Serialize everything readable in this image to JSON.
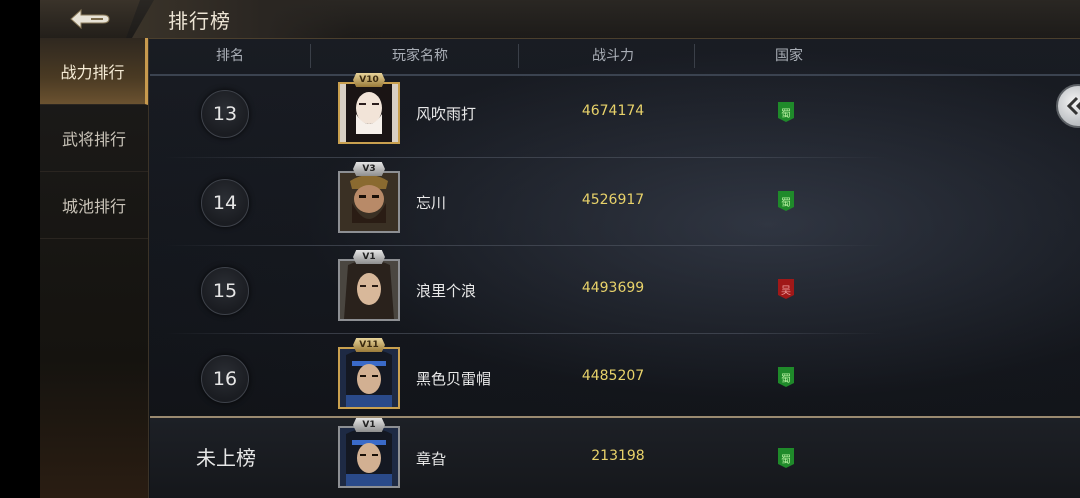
{
  "header": {
    "title": "排行榜"
  },
  "sidebar": {
    "items": [
      {
        "label": "战力排行",
        "active": true
      },
      {
        "label": "武将排行",
        "active": false
      },
      {
        "label": "城池排行",
        "active": false
      }
    ]
  },
  "table": {
    "columns": [
      "排名",
      "玩家名称",
      "战斗力",
      "国家"
    ],
    "rows": [
      {
        "rank": "13",
        "vip": "V10",
        "name": "风吹雨打",
        "power": "4674174",
        "country": "蜀",
        "country_color": "#1f8a2a"
      },
      {
        "rank": "14",
        "vip": "V3",
        "name": "忘川",
        "power": "4526917",
        "country": "蜀",
        "country_color": "#1f8a2a"
      },
      {
        "rank": "15",
        "vip": "V1",
        "name": "浪里个浪",
        "power": "4493699",
        "country": "吴",
        "country_color": "#a01818"
      },
      {
        "rank": "16",
        "vip": "V11",
        "name": "黑色贝雷帽",
        "power": "4485207",
        "country": "蜀",
        "country_color": "#1f8a2a"
      }
    ]
  },
  "own": {
    "rank": "未上榜",
    "vip": "V1",
    "name": "章旮",
    "power": "213198",
    "country": "蜀"
  },
  "colors": {
    "accent_gold": "#c89a4e",
    "power_text": "#e8d26a",
    "shu_green": "#1f8a2a",
    "wu_red": "#a01818"
  },
  "icons": {
    "back": "back-arrow-icon",
    "collapse": "double-chevron-left-icon"
  }
}
